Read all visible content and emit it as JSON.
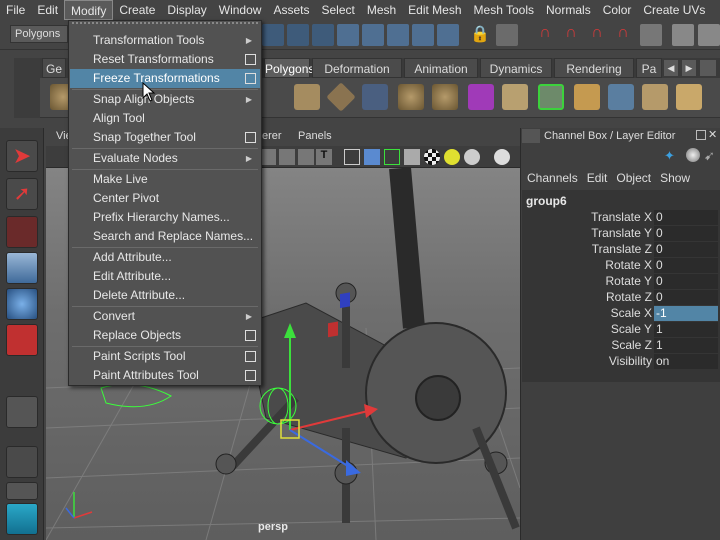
{
  "menubar": {
    "items": [
      "File",
      "Edit",
      "Modify",
      "Create",
      "Display",
      "Window",
      "Assets",
      "Select",
      "Mesh",
      "Edit Mesh",
      "Mesh Tools",
      "Normals",
      "Color",
      "Create UVs"
    ]
  },
  "statusline": {
    "mode": "Polygons"
  },
  "shelf": {
    "tabs": [
      "Ge",
      "Polygons",
      "Deformation",
      "Animation",
      "Dynamics",
      "Rendering",
      "Pa"
    ]
  },
  "viewport": {
    "menus": [
      "Vie",
      "erer",
      "Panels"
    ],
    "camera": "persp"
  },
  "modify_menu": {
    "items": [
      {
        "label": "Transformation Tools",
        "submenu": true,
        "option": false
      },
      {
        "label": "Reset Transformations",
        "submenu": false,
        "option": true
      },
      {
        "label": "Freeze Transformations",
        "submenu": false,
        "option": true,
        "highlighted": true
      },
      {
        "label": "Snap Align Objects",
        "submenu": true,
        "option": false
      },
      {
        "label": "Align Tool",
        "submenu": false,
        "option": false
      },
      {
        "label": "Snap Together Tool",
        "submenu": false,
        "option": true
      },
      {
        "label": "Evaluate Nodes",
        "submenu": true,
        "option": false
      },
      {
        "label": "Make Live",
        "submenu": false,
        "option": false
      },
      {
        "label": "Center Pivot",
        "submenu": false,
        "option": false
      },
      {
        "label": "Prefix Hierarchy Names...",
        "submenu": false,
        "option": false
      },
      {
        "label": "Search and Replace Names...",
        "submenu": false,
        "option": false
      },
      {
        "label": "Add Attribute...",
        "submenu": false,
        "option": false
      },
      {
        "label": "Edit Attribute...",
        "submenu": false,
        "option": false
      },
      {
        "label": "Delete Attribute...",
        "submenu": false,
        "option": false
      },
      {
        "label": "Convert",
        "submenu": true,
        "option": false
      },
      {
        "label": "Replace Objects",
        "submenu": false,
        "option": true
      },
      {
        "label": "Paint Scripts Tool",
        "submenu": false,
        "option": true
      },
      {
        "label": "Paint Attributes Tool",
        "submenu": false,
        "option": true
      }
    ]
  },
  "channel_box": {
    "title": "Channel Box / Layer Editor",
    "menus": [
      "Channels",
      "Edit",
      "Object",
      "Show"
    ],
    "object": "group6",
    "attributes": [
      {
        "name": "Translate X",
        "value": "0"
      },
      {
        "name": "Translate Y",
        "value": "0"
      },
      {
        "name": "Translate Z",
        "value": "0"
      },
      {
        "name": "Rotate X",
        "value": "0"
      },
      {
        "name": "Rotate Y",
        "value": "0"
      },
      {
        "name": "Rotate Z",
        "value": "0"
      },
      {
        "name": "Scale X",
        "value": "-1",
        "selected": true
      },
      {
        "name": "Scale Y",
        "value": "1"
      },
      {
        "name": "Scale Z",
        "value": "1"
      },
      {
        "name": "Visibility",
        "value": "on"
      }
    ]
  },
  "icons": [
    "select-tool-icon",
    "lasso-tool-icon",
    "paint-select-icon",
    "move-tool-icon",
    "rotate-tool-icon",
    "scale-tool-icon",
    "lock-icon",
    "magnet-icon",
    "maya-logo-icon"
  ],
  "colors": {
    "highlight": "#5285a6",
    "menu_bg": "#525252",
    "panel_bg": "#444444"
  }
}
